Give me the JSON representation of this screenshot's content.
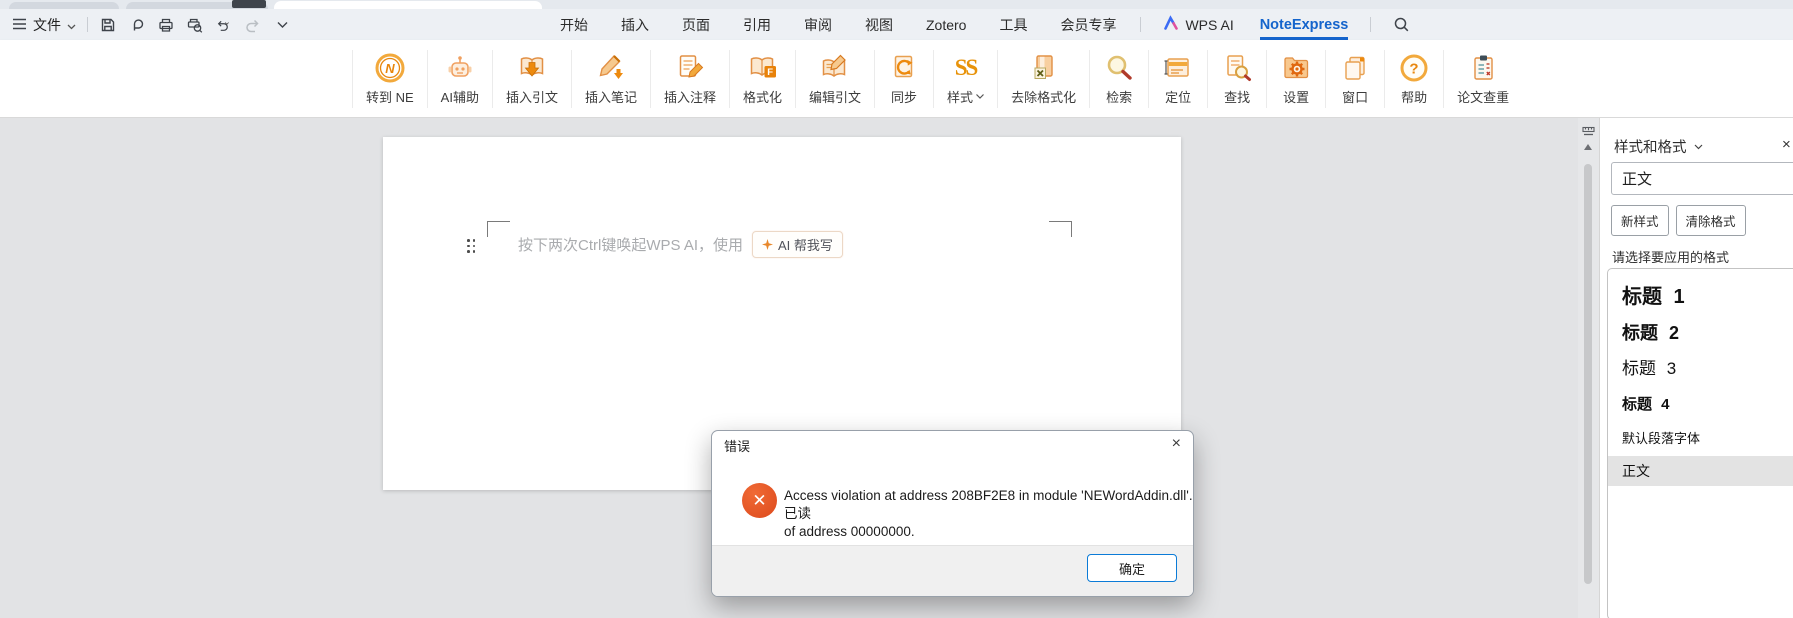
{
  "colors": {
    "noteexpress_blue": "#1464cc",
    "ribbon_orange": "#e8860c",
    "error_red": "#dd4a1d",
    "ok_button_border": "#0b7bd7",
    "selected_style_bg": "#e3e3e3"
  },
  "menubar": {
    "file_label": "文件",
    "quick_icons": [
      "save-icon",
      "export-icon",
      "print-icon",
      "print-preview-icon",
      "undo-icon",
      "redo-icon",
      "more-commands-icon"
    ],
    "tabs": [
      "开始",
      "插入",
      "页面",
      "引用",
      "审阅",
      "视图",
      "Zotero",
      "工具",
      "会员专享"
    ],
    "wps_ai_label": "WPS AI",
    "active_tab": "NoteExpress",
    "search_icon": "search-icon"
  },
  "ribbon": {
    "buttons": [
      {
        "label": "转到 NE",
        "icon": "ne-logo-icon"
      },
      {
        "label": "AI辅助",
        "icon": "robot-icon"
      },
      {
        "label": "插入引文",
        "icon": "insert-citation-icon"
      },
      {
        "label": "插入笔记",
        "icon": "insert-note-icon"
      },
      {
        "label": "插入注释",
        "icon": "insert-annotation-icon"
      },
      {
        "label": "格式化",
        "icon": "format-icon"
      },
      {
        "label": "编辑引文",
        "icon": "edit-citation-icon"
      },
      {
        "label": "同步",
        "icon": "sync-icon"
      },
      {
        "label": "样式",
        "icon": "style-ss-icon",
        "has_dropdown": true
      },
      {
        "label": "去除格式化",
        "icon": "remove-format-icon"
      },
      {
        "label": "检索",
        "icon": "retrieve-search-icon"
      },
      {
        "label": "定位",
        "icon": "locate-icon"
      },
      {
        "label": "查找",
        "icon": "find-icon"
      },
      {
        "label": "设置",
        "icon": "settings-gear-icon"
      },
      {
        "label": "窗口",
        "icon": "window-icon"
      },
      {
        "label": "帮助",
        "icon": "help-icon"
      },
      {
        "label": "论文查重",
        "icon": "plagiarism-check-icon"
      }
    ]
  },
  "document": {
    "placeholder": "按下两次Ctrl键唤起WPS AI，使用",
    "ai_pill_label": "AI 帮我写"
  },
  "dialog": {
    "title": "错误",
    "message_line1": "Access violation at address 208BF2E8 in module 'NEWordAddin.dll'. 已读",
    "message_line2": "of address 00000000.",
    "ok_label": "确定"
  },
  "sidebar": {
    "title": "样式和格式",
    "current_style": "正文",
    "new_style_label": "新样式",
    "clear_format_label": "清除格式",
    "hint": "请选择要应用的格式",
    "styles": [
      {
        "label": "标题 1"
      },
      {
        "label": "标题 2"
      },
      {
        "label": "标题 3"
      },
      {
        "label": "标题 4"
      },
      {
        "label": "默认段落字体"
      },
      {
        "label": "正文",
        "selected": true
      }
    ]
  }
}
